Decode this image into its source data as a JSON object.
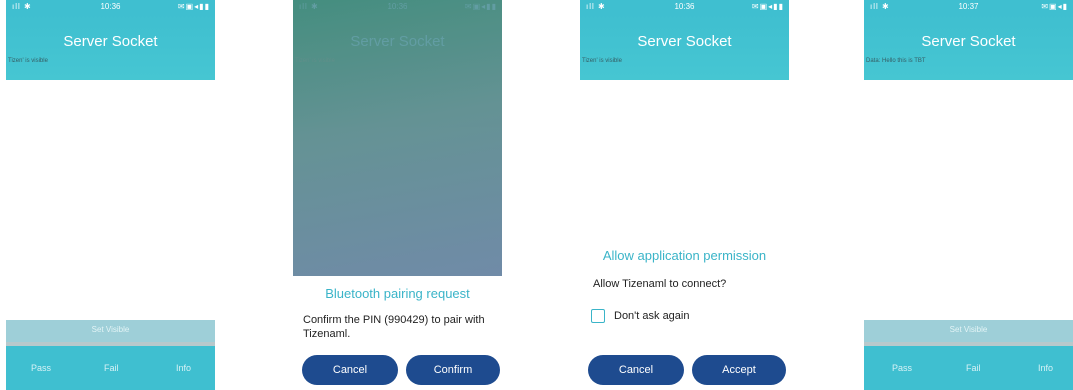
{
  "screen1": {
    "status": {
      "signal": "ıll ✱",
      "time": "10:36",
      "icons": "✉▣◂▮▮"
    },
    "title": "Server Socket",
    "status_text": "Tizen' is visible",
    "set_visible_label": "Set Visible",
    "bottom": {
      "pass": "Pass",
      "fail": "Fail",
      "info": "Info"
    }
  },
  "screen2": {
    "status": {
      "signal": "ıll ✱",
      "time": "10:36",
      "icons": "✉▣◂▮▮"
    },
    "title": "Server Socket",
    "status_text": "Tizen' is visible",
    "popup": {
      "title": "Bluetooth pairing request",
      "body": "Confirm the PIN (990429) to pair with Tizenaml.",
      "cancel": "Cancel",
      "confirm": "Confirm"
    }
  },
  "screen3": {
    "status": {
      "signal": "ıll ✱",
      "time": "10:36",
      "icons": "✉▣◂▮▮"
    },
    "title": "Server Socket",
    "status_text": "Tizen' is visible",
    "popup": {
      "title": "Allow application permission",
      "body": "Allow Tizenaml to connect?",
      "checkbox_label": "Don't ask again",
      "cancel": "Cancel",
      "accept": "Accept"
    }
  },
  "screen4": {
    "status": {
      "signal": "ıll ✱",
      "time": "10:37",
      "icons": "✉▣◂▮"
    },
    "title": "Server Socket",
    "status_text": "Data: Hello this is TBT",
    "set_visible_label": "Set Visible",
    "bottom": {
      "pass": "Pass",
      "fail": "Fail",
      "info": "Info"
    }
  },
  "colors": {
    "header": "#3fbfd0",
    "dialog_button": "#1e4b8f",
    "dialog_title": "#3ab4c8"
  }
}
